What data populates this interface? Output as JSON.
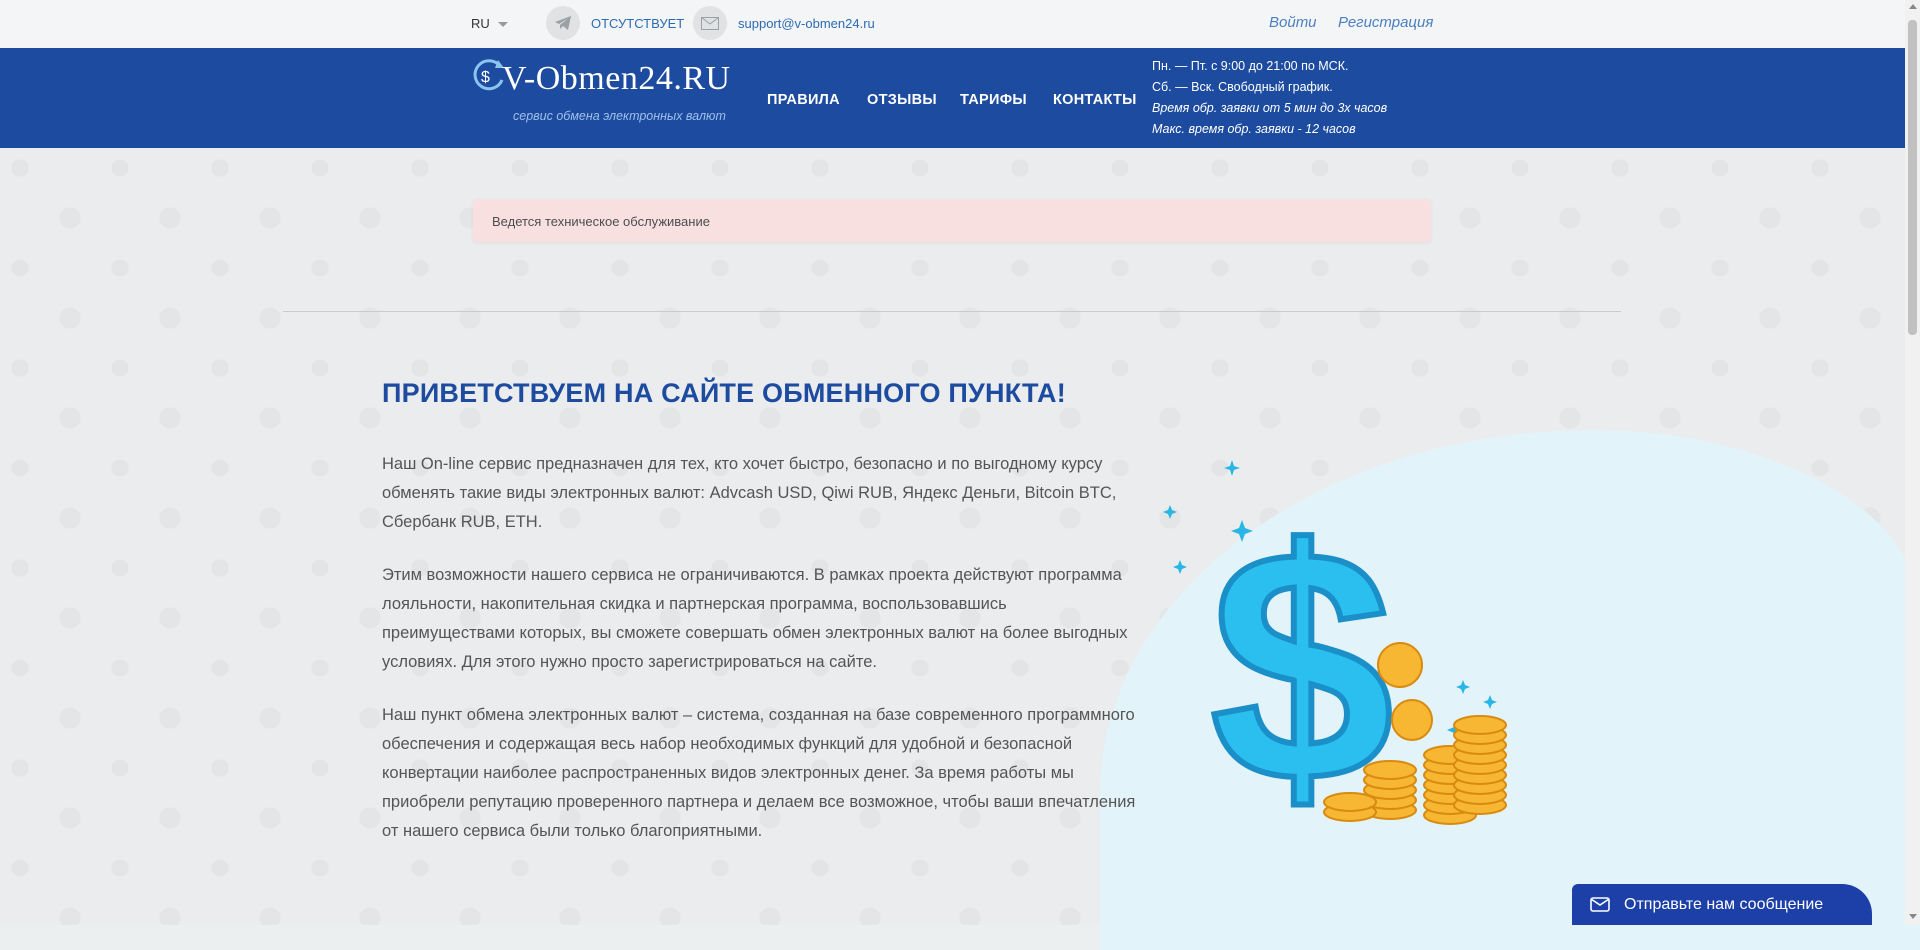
{
  "topbar": {
    "lang": "RU",
    "telegram_text": "ОТСУТСТВУЕТ",
    "email": "support@v-obmen24.ru",
    "login": "Войти",
    "register": "Регистрация"
  },
  "header": {
    "logo_text": "V-Obmen24.RU",
    "logo_subtitle": "сервис обмена электронных валют",
    "nav": [
      "ПРАВИЛА",
      "ОТЗЫВЫ",
      "ТАРИФЫ",
      "КОНТАКТЫ"
    ],
    "schedule": [
      "Пн. — Пт. с 9:00 до 21:00 по МСК.",
      "Сб. — Вск. Свободный график.",
      "Время обр. заявки от 5 мин до 3х часов",
      "Макс. время обр. заявки - 12 часов"
    ]
  },
  "notice": "Ведется техническое обслуживание",
  "main": {
    "title": "ПРИВЕТСТВУЕМ НА САЙТЕ ОБМЕННОГО ПУНКТА!",
    "paragraphs": [
      "Наш On-line сервис предназначен для тех, кто хочет быстро, безопасно и по выгодному курсу обменять такие виды электронных валют: Advcash USD, Qiwi RUB, Яндекс Деньги, Bitcoin BTC, Сбербанк RUB, ETH.",
      "Этим возможности нашего сервиса не ограничиваются. В рамках проекта действуют программа лояльности, накопительная скидка и партнерская программа, воспользовавшись преимуществами которых, вы сможете совершать обмен электронных валют на более выгодных условиях. Для этого нужно просто зарегистрироваться на сайте.",
      "Наш пункт обмена электронных валют – система, созданная на базе современного программного обеспечения и содержащая весь набор необходимых функций для удобной и безопасной конвертации наиболее распространенных видов электронных денег. За время работы мы приобрели репутацию проверенного партнера и делаем все возможное, чтобы ваши впечатления от нашего сервиса были только благоприятными."
    ]
  },
  "chat": {
    "label": "Отправьте нам сообщение"
  },
  "colors": {
    "brand_blue": "#1d4ba0",
    "notice_bg": "#f8e0e0",
    "accent_cyan": "#27b6e8"
  },
  "icons": [
    "telegram-icon",
    "mail-icon",
    "logo-dollar-icon",
    "chat-envelope-icon"
  ]
}
